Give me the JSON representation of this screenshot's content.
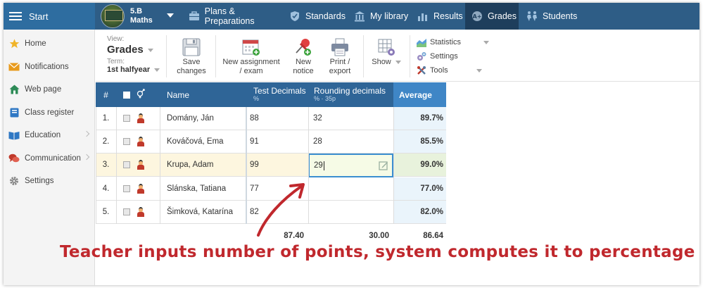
{
  "topbar": {
    "start_label": "Start",
    "class_line1": "5.B",
    "class_line2": "Maths",
    "nav": [
      {
        "label": "Plans & Preparations",
        "icon": "briefcase-icon"
      },
      {
        "label": "Standards",
        "icon": "shield-icon"
      },
      {
        "label": "My library",
        "icon": "library-icon"
      },
      {
        "label": "Results",
        "icon": "bar-chart-icon"
      },
      {
        "label": "Grades",
        "icon": "grades-icon",
        "active": true
      },
      {
        "label": "Students",
        "icon": "students-icon"
      }
    ]
  },
  "sidebar": {
    "items": [
      {
        "label": "Home",
        "icon": "star-icon",
        "color": "#f0b429"
      },
      {
        "label": "Notifications",
        "icon": "envelope-icon",
        "color": "#e89a1c"
      },
      {
        "label": "Web page",
        "icon": "house-icon",
        "color": "#2e8b57"
      },
      {
        "label": "Class register",
        "icon": "register-icon",
        "color": "#2f78c4"
      },
      {
        "label": "Education",
        "icon": "book-icon",
        "color": "#2f78c4",
        "chevron": true
      },
      {
        "label": "Communication",
        "icon": "chat-icon",
        "color": "#c0392b",
        "chevron": true
      },
      {
        "label": "Settings",
        "icon": "gear-icon",
        "color": "#888888"
      }
    ]
  },
  "toolbar": {
    "view_label": "View:",
    "view_value": "Grades",
    "term_label": "Term:",
    "term_value": "1st halfyear",
    "save_label": "Save changes",
    "new_assignment_label": "New assignment / exam",
    "new_notice_label": "New notice",
    "print_label": "Print / export",
    "show_label": "Show",
    "statistics_label": "Statistics",
    "settings_label": "Settings",
    "tools_label": "Tools"
  },
  "table": {
    "headers": {
      "num": "#",
      "name": "Name",
      "col1_title": "Test Decimals",
      "col1_sub": "%",
      "col2_title": "Rounding decimals",
      "col2_sub": "% · 35p",
      "avg": "Average"
    },
    "rows": [
      {
        "num": "1.",
        "name": "Domány, Ján",
        "c1": "88",
        "c2": "32",
        "avg": "89.7%"
      },
      {
        "num": "2.",
        "name": "Kováčová, Ema",
        "c1": "91",
        "c2": "28",
        "avg": "85.5%"
      },
      {
        "num": "3.",
        "name": "Krupa, Adam",
        "c1": "99",
        "c2": "29",
        "avg": "99.0%",
        "selected": true
      },
      {
        "num": "4.",
        "name": "Slánska, Tatiana",
        "c1": "77",
        "c2": "",
        "avg": "77.0%"
      },
      {
        "num": "5.",
        "name": "Šimková, Katarína",
        "c1": "82",
        "c2": "",
        "avg": "82.0%"
      }
    ],
    "footer": {
      "c1": "87.40",
      "c2": "30.00",
      "avg": "86.64"
    }
  },
  "annotation": "Teacher inputs number of points, system computes it to percentage",
  "colors": {
    "topbar": "#2e5d86",
    "header": "#2f6597",
    "average_header": "#3f86c6",
    "average_cell": "#eaf4fb",
    "selected_row": "#fdf6df",
    "annotation": "#c0282d"
  }
}
